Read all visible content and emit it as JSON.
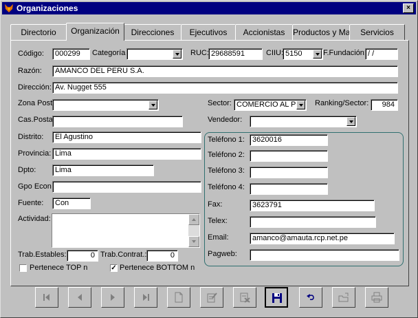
{
  "window": {
    "title": "Organizaciones",
    "close_glyph": "×"
  },
  "tabs": [
    {
      "label": "Directorio",
      "active": false
    },
    {
      "label": "Organización",
      "active": true
    },
    {
      "label": "Direcciones",
      "active": false
    },
    {
      "label": "Ejecutivos",
      "active": false
    },
    {
      "label": "Accionistas",
      "active": false
    },
    {
      "label": "Productos y Mar",
      "active": false
    },
    {
      "label": "Servicios",
      "active": false
    }
  ],
  "form": {
    "codigo": {
      "label": "Código:",
      "value": "000299"
    },
    "categoria": {
      "label": "Categoría",
      "value": ""
    },
    "ruc": {
      "label": "RUC:",
      "value": "29688591"
    },
    "ciiu": {
      "label": "CIIU:",
      "value": "5150"
    },
    "fundacion": {
      "label": "F.Fundación:",
      "value": " /  /"
    },
    "razon": {
      "label": "Razón:",
      "value": "AMANCO DEL PERU S.A."
    },
    "direccion": {
      "label": "Dirección:",
      "value": "Av. Nugget 555"
    },
    "zona_postal": {
      "label": "Zona Post",
      "value": ""
    },
    "sector": {
      "label": "Sector:",
      "value": "COMERCIO AL POI"
    },
    "ranking": {
      "label": "Ranking/Sector:",
      "value": "984"
    },
    "cas_postal": {
      "label": "Cas.Posta",
      "value": ""
    },
    "vendedor": {
      "label": "Vendedor:",
      "value": ""
    },
    "distrito": {
      "label": "Distrito:",
      "value": "El Agustino"
    },
    "provincia": {
      "label": "Provincia:",
      "value": "Lima"
    },
    "dpto": {
      "label": "Dpto:",
      "value": "Lima"
    },
    "gpo_econ": {
      "label": "Gpo Econ",
      "value": ""
    },
    "fuente": {
      "label": "Fuente:",
      "value": "Con"
    },
    "actividad": {
      "label": "Actividad:",
      "value": ""
    },
    "trab_estables": {
      "label": "Trab.Estables:",
      "value": "0"
    },
    "trab_contrat": {
      "label": "Trab.Contrat.:",
      "value": "0"
    },
    "top": {
      "label": "Pertenece TOP n",
      "checked": false
    },
    "bottom": {
      "label": "Pertenece BOTTOM n",
      "checked": true,
      "check_glyph": "✓"
    },
    "telefono1": {
      "label": "Teléfono 1:",
      "value": "3620016"
    },
    "telefono2": {
      "label": "Teléfono 2:",
      "value": ""
    },
    "telefono3": {
      "label": "Teléfono 3:",
      "value": ""
    },
    "telefono4": {
      "label": "Teléfono 4:",
      "value": ""
    },
    "fax": {
      "label": "Fax:",
      "value": "3623791"
    },
    "telex": {
      "label": "Telex:",
      "value": ""
    },
    "email": {
      "label": "Email:",
      "value": "amanco@amauta.rcp.net.pe"
    },
    "pagweb": {
      "label": "Pagweb:",
      "value": ""
    }
  },
  "toolbar_icons": [
    "first-record-icon",
    "prev-record-icon",
    "next-record-icon",
    "last-record-icon",
    "new-record-icon",
    "edit-record-icon",
    "delete-record-icon",
    "save-icon",
    "undo-icon",
    "open-folder-icon",
    "print-icon"
  ],
  "colors": {
    "title_bar": "#000080",
    "window": "#c0c0c0",
    "group_border": "#2f6f6f",
    "save_icon": "#000080"
  }
}
